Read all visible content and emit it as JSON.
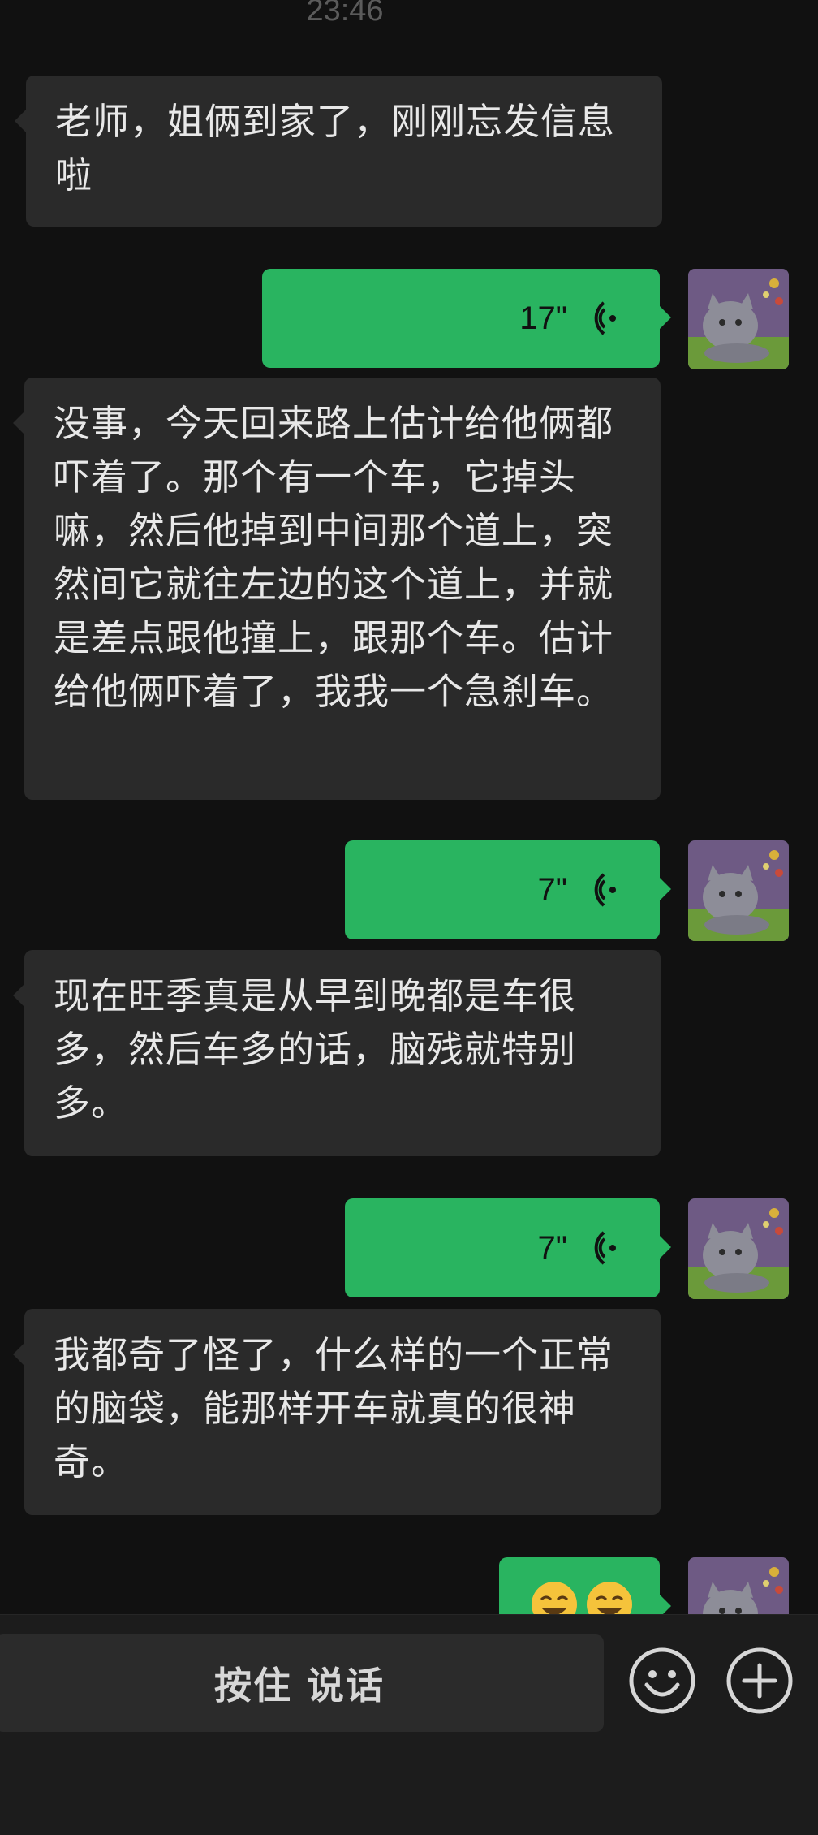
{
  "chat": {
    "timestamp": "23:46",
    "messages": [
      {
        "side": "in",
        "type": "text",
        "text": "老师，姐俩到家了，刚刚忘发信息啦"
      },
      {
        "side": "out",
        "type": "voice",
        "duration": "17\""
      },
      {
        "side": "in",
        "type": "text",
        "text": "没事，今天回来路上估计给他俩都吓着了。那个有一个车，它掉头嘛，然后他掉到中间那个道上，突然间它就往左边的这个道上，并就是差点跟他撞上，跟那个车。估计给他俩吓着了，我我一个急刹车。"
      },
      {
        "side": "out",
        "type": "voice",
        "duration": "7\""
      },
      {
        "side": "in",
        "type": "text",
        "text": "现在旺季真是从早到晚都是车很多，然后车多的话，脑残就特别多。"
      },
      {
        "side": "out",
        "type": "voice",
        "duration": "7\""
      },
      {
        "side": "in",
        "type": "text",
        "text": "我都奇了怪了，什么样的一个正常的脑袋，能那样开车就真的很神奇。"
      },
      {
        "side": "out",
        "type": "emoji",
        "emoji": "😂😂"
      }
    ]
  },
  "input_bar": {
    "hold_to_talk_label": "按住 说话",
    "emoji_icon": "smiley-face-icon",
    "plus_icon": "plus-circle-icon"
  },
  "colors": {
    "background": "#111111",
    "incoming_bubble": "#2a2a2a",
    "outgoing_bubble": "#29b460",
    "bottom_bar": "#1c1c1c"
  }
}
